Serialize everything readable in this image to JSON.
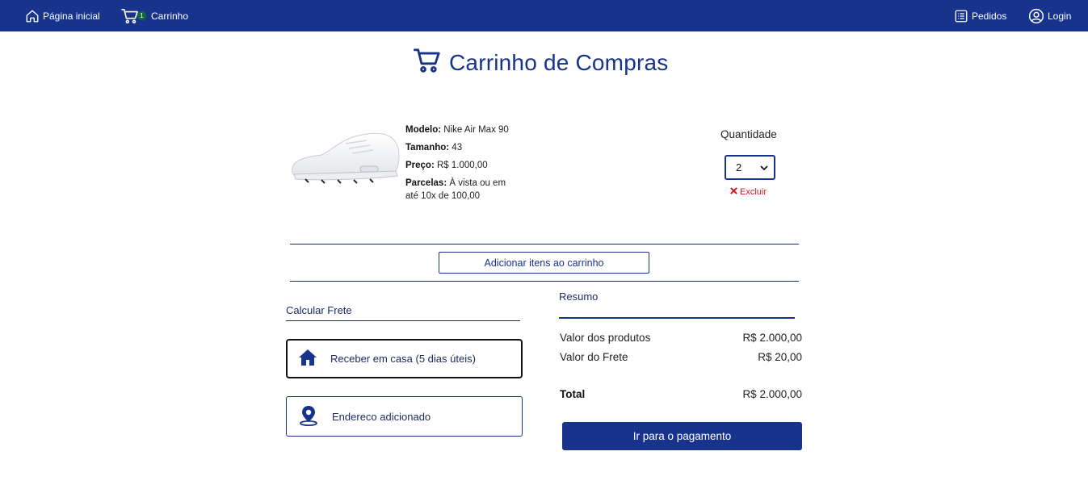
{
  "nav": {
    "home_label": "Página inicial",
    "cart_label": "Carrinho",
    "cart_count": "1",
    "orders_label": "Pedidos",
    "login_label": "Login"
  },
  "page": {
    "title": "Carrinho de Compras"
  },
  "product": {
    "model_key": "Modelo:",
    "model": "Nike Air Max 90",
    "size_key": "Tamanho:",
    "size": "43",
    "price_key": "Preço:",
    "price": "R$ 1.000,00",
    "installments_key": "Parcelas:",
    "installments": "À vista ou em até 10x de 100,00",
    "image_icon": "sneaker-image"
  },
  "quantity": {
    "label": "Quantidade",
    "value": "2",
    "remove_label": "Excluir"
  },
  "cart_actions": {
    "add_items_label": "Adicionar itens ao carrinho"
  },
  "shipping": {
    "title": "Calcular Frete",
    "options": [
      {
        "label": "Receber em casa (5 dias úteis)",
        "icon": "home-icon"
      },
      {
        "label": "Endereco adicionado",
        "icon": "map-pin-icon"
      }
    ]
  },
  "summary": {
    "title": "Resumo",
    "products_label": "Valor dos produtos",
    "products_value": "R$ 2.000,00",
    "shipping_label": "Valor do Frete",
    "shipping_value": "R$ 20,00",
    "total_label": "Total",
    "total_value": "R$ 2.000,00",
    "pay_label": "Ir para o pagamento"
  },
  "colors": {
    "brand": "#17338b",
    "badge": "#0f6b3a",
    "danger": "#d8161b"
  }
}
